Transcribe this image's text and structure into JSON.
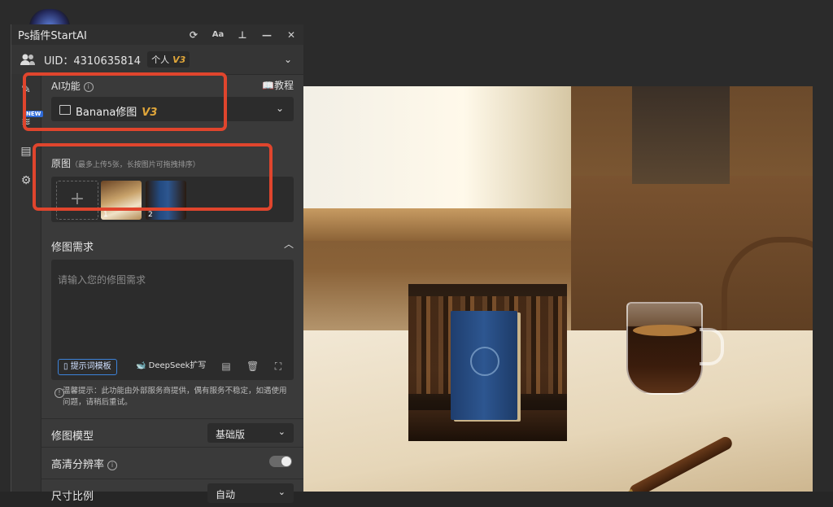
{
  "panel": {
    "title": "Ps插件StartAI",
    "uid_label": "UID：4310635814",
    "plan": "个人",
    "plan_version": "V3",
    "new_tag": "NEW"
  },
  "ai_function": {
    "label": "AI功能",
    "tutorial": "教程",
    "selected": "Banana修图",
    "selected_version": "V3"
  },
  "source_images": {
    "label": "原图",
    "hint": "（最多上传5张，长按图片可拖拽排序）",
    "images": [
      {
        "index": "1"
      },
      {
        "index": "2"
      }
    ]
  },
  "edit_request": {
    "label": "修图需求",
    "placeholder": "请输入您的修图需求",
    "template_button": "提示词模板",
    "deepseek_button": "DeepSeek扩写",
    "notice": "温馨提示：此功能由外部服务商提供，偶有服务不稳定，如遇使用问题，请稍后重试。"
  },
  "settings": {
    "model_label": "修图模型",
    "model_value": "基础版",
    "hd_label": "高清分辨率",
    "hd_enabled": false,
    "ratio_label": "尺寸比例",
    "ratio_value": "自动"
  },
  "colors": {
    "accent": "#e0a63a",
    "highlight": "#e0452d",
    "link_blue": "#3c82d9"
  }
}
